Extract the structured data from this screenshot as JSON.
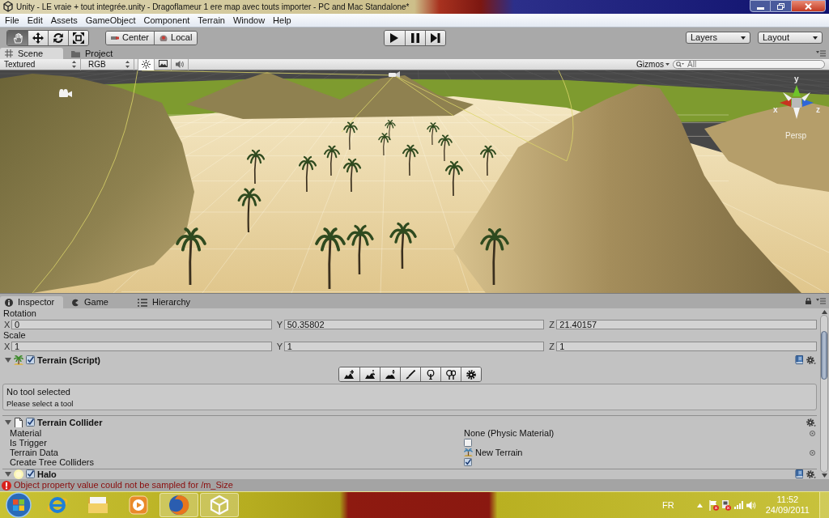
{
  "window": {
    "title": "Unity - LE vraie + tout integrée.unity - Dragoflameur 1 ere map avec touts importer - PC and Mac Standalone*"
  },
  "menu_bar": [
    "File",
    "Edit",
    "Assets",
    "GameObject",
    "Component",
    "Terrain",
    "Window",
    "Help"
  ],
  "toolbar": {
    "transform_tools": [
      {
        "kind": "hand",
        "selected": true
      },
      {
        "kind": "move",
        "selected": false
      },
      {
        "kind": "rotate",
        "selected": false
      },
      {
        "kind": "scale",
        "selected": false
      }
    ],
    "pivot_buttons": [
      {
        "kind": "pivot",
        "label": "Center"
      },
      {
        "kind": "space",
        "label": "Local"
      }
    ],
    "playback": [
      {
        "kind": "play"
      },
      {
        "kind": "pause"
      },
      {
        "kind": "step"
      }
    ],
    "dropdowns": [
      {
        "label": "Layers"
      },
      {
        "label": "Layout"
      }
    ]
  },
  "scene_panel": {
    "tabs": [
      {
        "kind": "scene",
        "label": "Scene",
        "selected": true
      },
      {
        "kind": "project",
        "label": "Project",
        "selected": false
      }
    ],
    "render_mode": "Textured",
    "channel": "RGB",
    "toggles": [
      {
        "kind": "lighting",
        "on": true
      },
      {
        "kind": "image",
        "on": false
      },
      {
        "kind": "audio",
        "on": false
      }
    ],
    "gizmos": "Gizmos",
    "search": {
      "placeholder": "All"
    },
    "axis_gizmo": {
      "y_label": "y",
      "x_label": "x",
      "z_label": "z",
      "projection": "Persp"
    }
  },
  "bottom_panel": {
    "tabs": [
      {
        "kind": "inspector",
        "label": "Inspector",
        "selected": true
      },
      {
        "kind": "game",
        "label": "Game",
        "selected": false
      },
      {
        "kind": "hierarchy",
        "label": "Hierarchy",
        "selected": false
      }
    ],
    "inspector": {
      "vectors": [
        {
          "label": "Rotation",
          "fields": [
            {
              "axis": "X",
              "value": "0"
            },
            {
              "axis": "Y",
              "value": "50.35802"
            },
            {
              "axis": "Z",
              "value": "21.40157"
            }
          ]
        },
        {
          "label": "Scale",
          "fields": [
            {
              "axis": "X",
              "value": "1"
            },
            {
              "axis": "Y",
              "value": "1"
            },
            {
              "axis": "Z",
              "value": "1"
            }
          ]
        }
      ],
      "components": [
        {
          "kind": "terrain",
          "title": "Terrain (Script)",
          "expanded": true,
          "enabled": true,
          "help": true,
          "tools": [
            {
              "kind": "raise_lower",
              "selected": false
            },
            {
              "kind": "paint_height",
              "selected": false
            },
            {
              "kind": "smooth_height",
              "selected": false
            },
            {
              "kind": "paint_texture",
              "selected": false
            },
            {
              "kind": "place_trees",
              "selected": false
            },
            {
              "kind": "paint_details",
              "selected": false
            },
            {
              "kind": "settings",
              "selected": false
            }
          ],
          "message": {
            "title": "No tool selected",
            "text": "Please select a tool"
          }
        },
        {
          "kind": "collider",
          "title": "Terrain Collider",
          "expanded": true,
          "enabled": true,
          "help": false,
          "properties": [
            {
              "kind": "object",
              "label": "Material",
              "value": "None (Physic Material)"
            },
            {
              "kind": "toggle",
              "label": "Is Trigger",
              "checked": false
            },
            {
              "kind": "asset",
              "label": "Terrain Data",
              "value": "New Terrain"
            },
            {
              "kind": "toggle",
              "label": "Create Tree Colliders",
              "checked": true
            }
          ]
        },
        {
          "kind": "halo",
          "title": "Halo",
          "expanded": true,
          "enabled": true,
          "help": true
        }
      ]
    }
  },
  "status_bar": {
    "kind": "error",
    "message": "Object property value could not be sampled for /m_Size"
  },
  "taskbar": {
    "apps": [
      {
        "kind": "ie",
        "running": false
      },
      {
        "kind": "explorer",
        "running": false
      },
      {
        "kind": "media_player",
        "running": false
      },
      {
        "kind": "firefox",
        "running": true
      },
      {
        "kind": "unity",
        "running": true
      }
    ],
    "language": "FR",
    "time": "11:52",
    "date": "24/09/2011"
  }
}
